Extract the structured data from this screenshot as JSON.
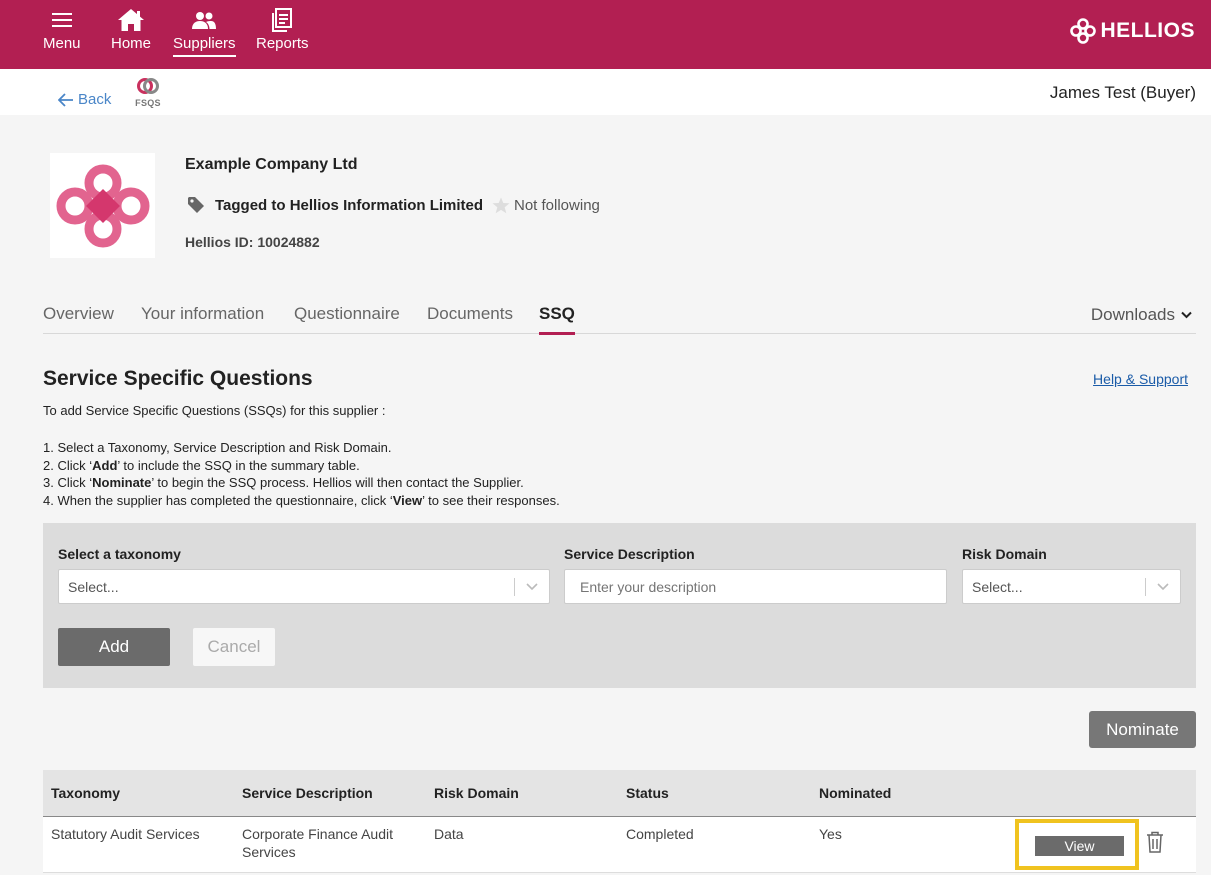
{
  "nav": {
    "menu": "Menu",
    "home": "Home",
    "suppliers": "Suppliers",
    "reports": "Reports",
    "brand": "HELLIOS"
  },
  "subbar": {
    "back": "Back",
    "fsqs": "FSQS",
    "user": "James Test (Buyer)"
  },
  "company": {
    "name": "Example Company Ltd",
    "tag": "Tagged to Hellios Information Limited",
    "follow": "Not following",
    "hellios_id": "Hellios ID: 10024882"
  },
  "tabs": [
    {
      "label": "Overview"
    },
    {
      "label": "Your information"
    },
    {
      "label": "Questionnaire"
    },
    {
      "label": "Documents"
    },
    {
      "label": "SSQ"
    }
  ],
  "downloads": "Downloads",
  "ssq": {
    "title": "Service Specific Questions",
    "help": "Help & Support",
    "intro": "To add Service Specific Questions (SSQs) for this supplier :",
    "steps": [
      {
        "pre": "1. Select a Taxonomy, Service Description and Risk Domain.",
        "bold": "",
        "post": ""
      },
      {
        "pre": "2. Click ‘",
        "bold": "Add",
        "post": "’ to include the SSQ in the summary table."
      },
      {
        "pre": "3. Click ‘",
        "bold": "Nominate",
        "post": "’ to begin the SSQ process. Hellios will then contact the Supplier."
      },
      {
        "pre": "4. When the supplier has completed the questionnaire, click ‘",
        "bold": "View",
        "post": "’ to see their responses."
      }
    ]
  },
  "form": {
    "taxonomy_label": "Select a taxonomy",
    "taxonomy_placeholder": "Select...",
    "description_label": "Service Description",
    "description_placeholder": "Enter your description",
    "risk_label": "Risk Domain",
    "risk_placeholder": "Select...",
    "add": "Add",
    "cancel": "Cancel"
  },
  "nominate": "Nominate",
  "table": {
    "headers": [
      "Taxonomy",
      "Service Description",
      "Risk Domain",
      "Status",
      "Nominated"
    ],
    "rows": [
      {
        "taxonomy": "Statutory Audit Services",
        "description": "Corporate Finance Audit Services",
        "risk": "Data",
        "status": "Completed",
        "nominated": "Yes",
        "view": "View"
      }
    ]
  },
  "colors": {
    "brand": "#b21f52",
    "highlight": "#f0c31f"
  }
}
